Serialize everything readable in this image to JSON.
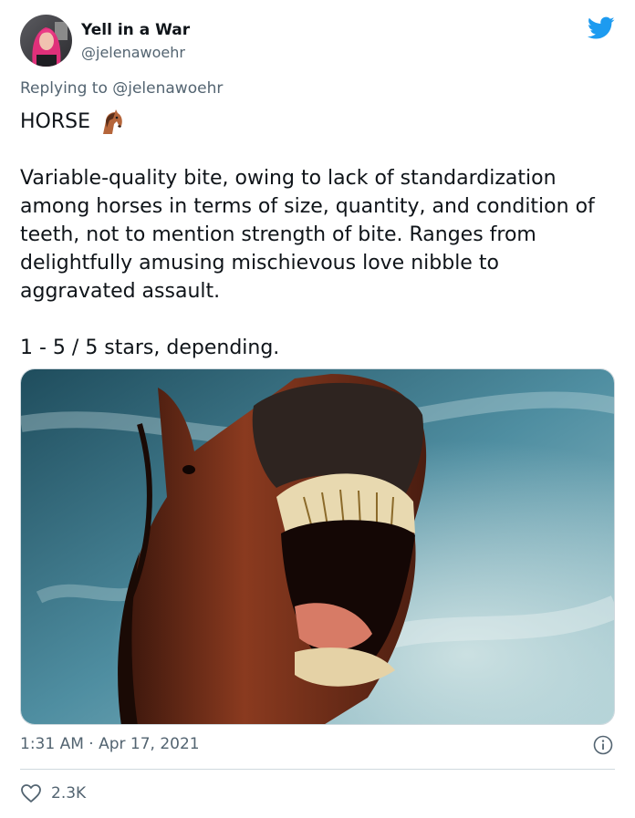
{
  "tweet": {
    "author": {
      "display_name": "Yell in a War",
      "handle": "@jelenawoehr",
      "avatar_icon": "avatar-photo"
    },
    "brand_icon": "twitter-bird-icon",
    "brand_color": "#1d9bf0",
    "replying_prefix": "Replying to",
    "replying_to": "@jelenawoehr",
    "title": "HORSE",
    "title_emoji": "horse-face-emoji",
    "paragraphs": [
      "Variable-quality bite, owing to lack of standardization among horses in terms of size, quantity, and condition of teeth, not to mention strength of bite. Ranges from delightfully amusing mischievous love nibble to aggravated assault.",
      "1 - 5 / 5 stars, depending."
    ],
    "media": {
      "icon": "horse-photo"
    },
    "timestamp": "1:31 AM · Apr 17, 2021",
    "info_icon": "info-icon",
    "like_icon": "heart-icon",
    "like_count": "2.3K"
  }
}
